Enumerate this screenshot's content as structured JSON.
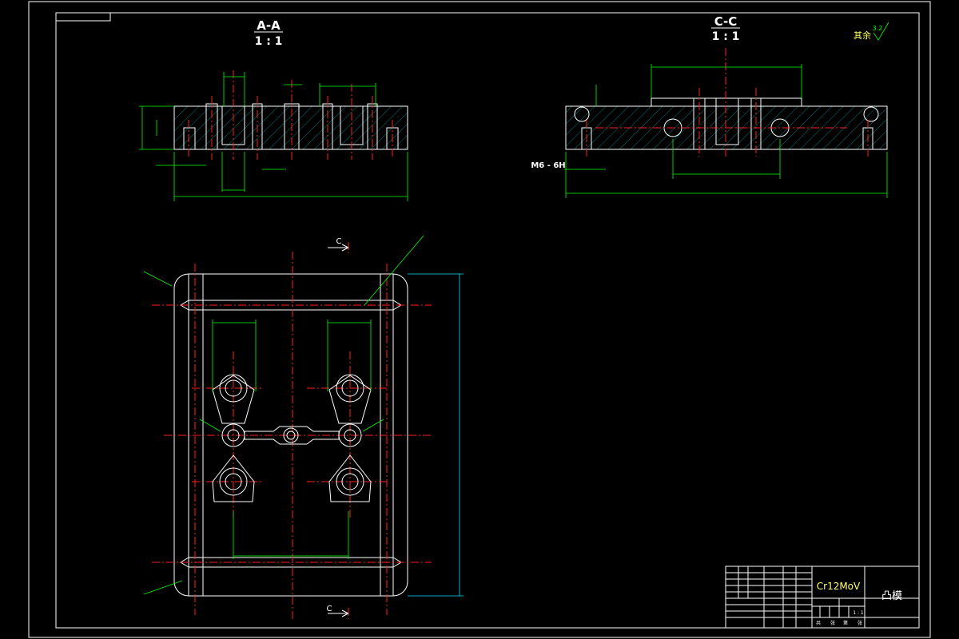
{
  "views": {
    "section_aa": {
      "title": "A-A",
      "scale": "1 : 1"
    },
    "section_cc": {
      "title": "C-C",
      "scale": "1 : 1"
    }
  },
  "roughness": {
    "label": "其余",
    "value": "3.2"
  },
  "thread_note": "M6 - 6H",
  "section_markers": {
    "top": "C",
    "bottom": "C"
  },
  "title_block": {
    "material": "Cr12MoV",
    "part_name": "凸模",
    "scale": "1 : 1",
    "sheet_label_total": "共",
    "sheet_label_sheet": "张",
    "sheet_label_num": "第",
    "sheet_label_end": "张"
  },
  "colors": {
    "outline": "#ffffff",
    "center": "#ff2020",
    "dimension": "#00ff00",
    "hatch": "#00c8c8",
    "extent": "#00e0ff"
  }
}
